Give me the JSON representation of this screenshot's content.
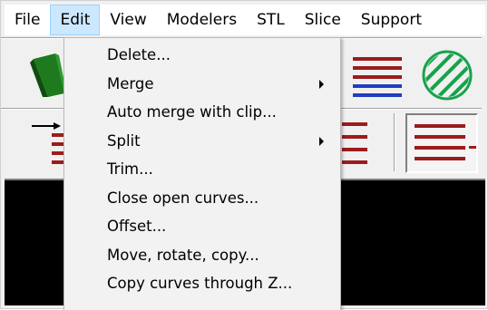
{
  "menubar": {
    "items": [
      {
        "label": "File"
      },
      {
        "label": "Edit",
        "active": true
      },
      {
        "label": "View"
      },
      {
        "label": "Modelers"
      },
      {
        "label": "STL"
      },
      {
        "label": "Slice"
      },
      {
        "label": "Support"
      }
    ]
  },
  "edit_menu": {
    "items": [
      {
        "label": "Delete...",
        "submenu": false
      },
      {
        "label": "Merge",
        "submenu": true
      },
      {
        "label": "Auto merge with clip...",
        "submenu": false
      },
      {
        "label": "Split",
        "submenu": true
      },
      {
        "label": "Trim...",
        "submenu": false
      },
      {
        "label": "Close open curves...",
        "submenu": false
      },
      {
        "label": "Offset...",
        "submenu": false
      },
      {
        "label": "Move, rotate, copy...",
        "submenu": false
      },
      {
        "label": "Copy curves through Z...",
        "submenu": false
      }
    ]
  },
  "toolbar": {
    "icons": [
      "green-model-icon",
      "slice-layers-icon",
      "hatch-circle-icon",
      "arrow-layers-icon",
      "layers-icon",
      "layers-selected-icon"
    ]
  },
  "colors": {
    "menu_highlight_bg": "#cce8ff",
    "menu_highlight_border": "#99d1ff",
    "layer_red": "#9b1c1c",
    "layer_blue": "#1f3fbf",
    "hatch_green": "#16a34a",
    "model_green": "#1f7a1f"
  }
}
